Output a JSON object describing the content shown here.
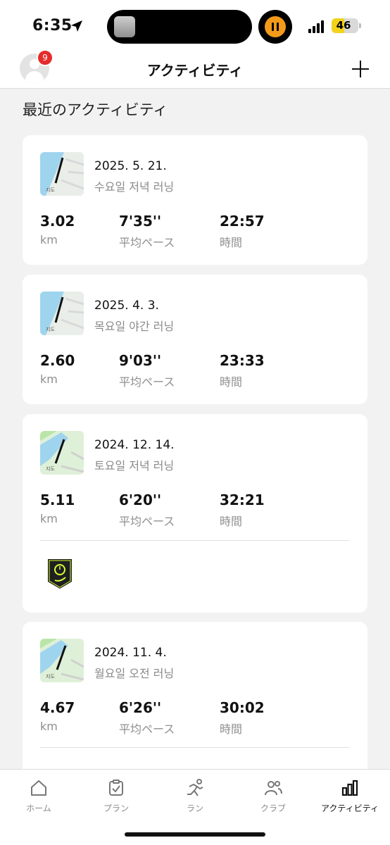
{
  "status_bar": {
    "time": "6:35",
    "battery": "46"
  },
  "header": {
    "title": "アクティビティ",
    "notification_count": "9"
  },
  "section_title": "最近のアクティビティ",
  "map_label": "지도",
  "activities": [
    {
      "date": "2025. 5. 21.",
      "name": "수요일 저녁 러닝",
      "distance": "3.02",
      "distance_unit": "km",
      "pace": "7'35''",
      "pace_label": "平均ペース",
      "time": "22:57",
      "time_label": "時間"
    },
    {
      "date": "2025. 4. 3.",
      "name": "목요일 야간 러닝",
      "distance": "2.60",
      "distance_unit": "km",
      "pace": "9'03''",
      "pace_label": "平均ペース",
      "time": "23:33",
      "time_label": "時間"
    },
    {
      "date": "2024. 12. 14.",
      "name": "토요일 저녁 러닝",
      "distance": "5.11",
      "distance_unit": "km",
      "pace": "6'20''",
      "pace_label": "平均ペース",
      "time": "32:21",
      "time_label": "時間"
    },
    {
      "date": "2024. 11. 4.",
      "name": "월요일 오전 러닝",
      "distance": "4.67",
      "distance_unit": "km",
      "pace": "6'26''",
      "pace_label": "平均ペース",
      "time": "30:02",
      "time_label": "時間"
    }
  ],
  "tabs": [
    {
      "label": "ホーム",
      "icon": "home-icon"
    },
    {
      "label": "プラン",
      "icon": "plan-icon"
    },
    {
      "label": "ラン",
      "icon": "run-icon"
    },
    {
      "label": "クラブ",
      "icon": "club-icon"
    },
    {
      "label": "アクティビティ",
      "icon": "activity-icon",
      "active": true
    }
  ],
  "colors": {
    "accent_timer": "#f39a1a",
    "badge": "#e52b2b",
    "battery": "#f2d21b",
    "achievement": "#d4ff3a"
  }
}
